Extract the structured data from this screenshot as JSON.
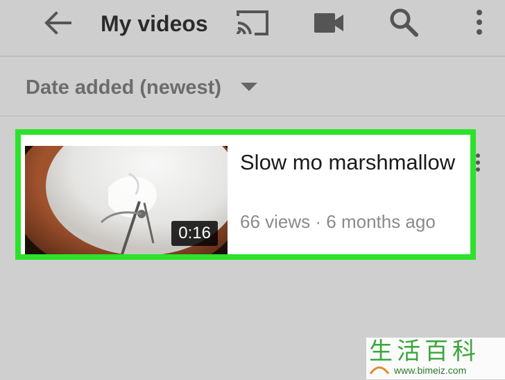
{
  "header": {
    "title": "My videos",
    "icons": [
      "back-arrow-icon",
      "cast-icon",
      "video-camera-icon",
      "search-icon",
      "more-vert-icon"
    ]
  },
  "sort": {
    "label": "Date added (newest)"
  },
  "videos": [
    {
      "title": "Slow mo marshmallow",
      "duration": "0:16",
      "meta": "66 views · 6 months ago"
    }
  ],
  "highlight_color": "#2ce22b",
  "watermark": {
    "chars": "生活百科",
    "url": "www.bimeiz.com"
  }
}
